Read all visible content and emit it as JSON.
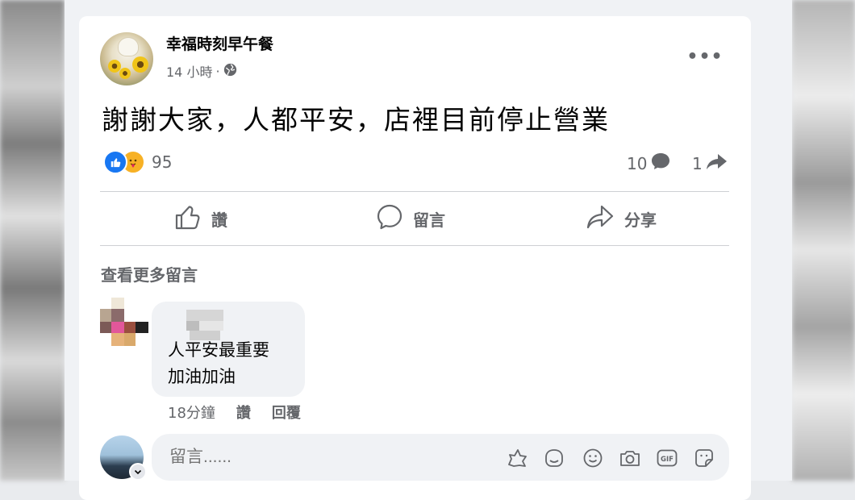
{
  "post": {
    "page_name": "幸福時刻早午餐",
    "time": "14 小時",
    "separator": "·",
    "globe_icon": "globe-icon",
    "more_label": "•••",
    "text": "謝謝大家，人都平安，店裡目前停止營業",
    "reactions": {
      "types": [
        "like",
        "care"
      ],
      "count": "95"
    },
    "comments_count": "10",
    "shares_count": "1"
  },
  "actions": [
    {
      "label": "讚",
      "icon": "thumbs-up-icon"
    },
    {
      "label": "留言",
      "icon": "comment-icon"
    },
    {
      "label": "分享",
      "icon": "share-arrow-icon"
    }
  ],
  "see_more_comments": "查看更多留言",
  "comment": {
    "lines": [
      "人平安最重要",
      "加油加油"
    ],
    "time": "18分鐘",
    "like_label": "讚",
    "reply_label": "回覆"
  },
  "composer": {
    "placeholder": "留言......",
    "icons": [
      "avatar-sticker-icon",
      "sticker-icon",
      "emoji-icon",
      "camera-icon",
      "gif-icon",
      "sticker-smile-icon"
    ]
  },
  "colors": {
    "like_blue": "#1877f2",
    "care_yellow": "#f7b125",
    "secondary_text": "#65676b",
    "bubble_bg": "#f0f2f5"
  }
}
